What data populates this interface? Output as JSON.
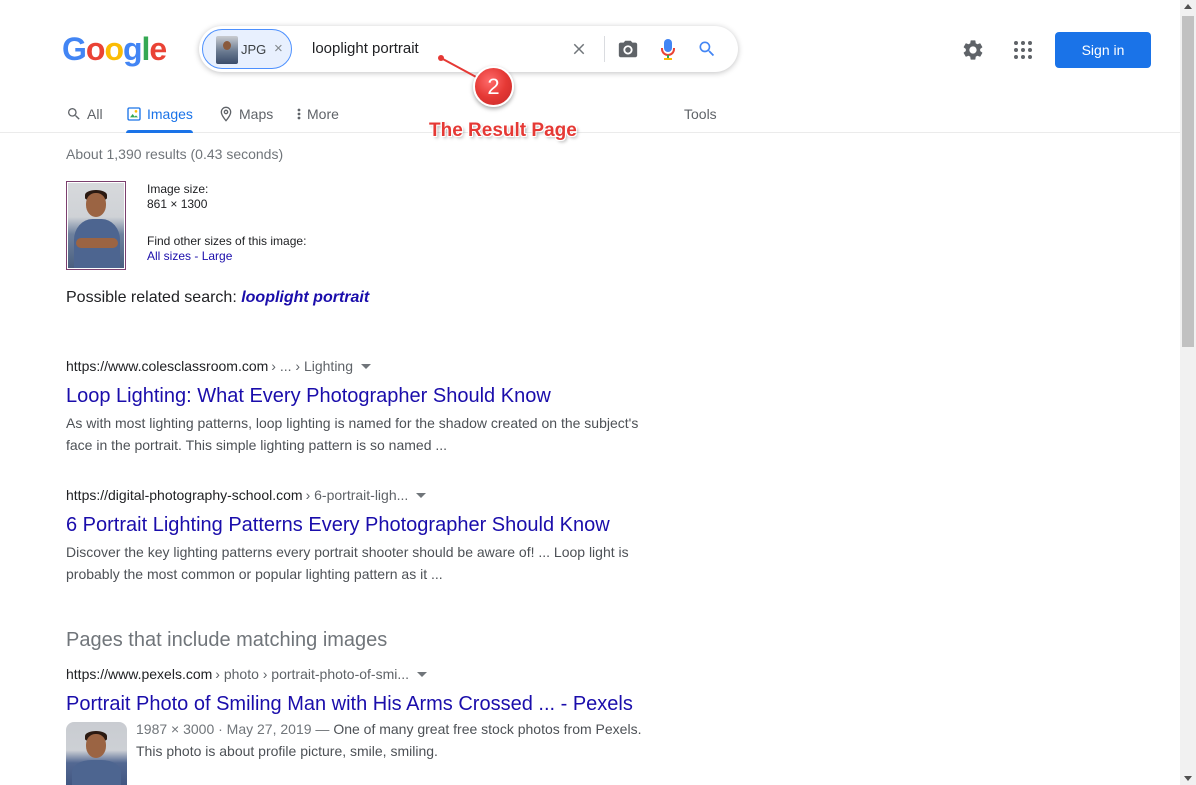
{
  "logo": {
    "letters": [
      "G",
      "o",
      "o",
      "g",
      "l",
      "e"
    ],
    "colors": [
      "#4285F4",
      "#EA4335",
      "#FBBC05",
      "#4285F4",
      "#34A853",
      "#EA4335"
    ]
  },
  "search": {
    "chip_label": "JPG",
    "chip_remove": "×",
    "query": "looplight portrait",
    "clear_icon": "close-icon",
    "camera_icon": "camera-icon",
    "mic_icon": "mic-icon",
    "search_icon": "search-icon"
  },
  "header": {
    "signin_label": "Sign in",
    "settings_icon": "gear-icon",
    "apps_icon": "apps-grid-icon",
    "accent": "#1a73e8"
  },
  "tabs": [
    {
      "label": "All",
      "icon": "search-icon",
      "active": false
    },
    {
      "label": "Images",
      "icon": "image-icon",
      "active": true
    },
    {
      "label": "Maps",
      "icon": "map-pin-icon",
      "active": false
    },
    {
      "label": "More",
      "icon": "more-vert-icon",
      "active": false
    }
  ],
  "tools_label": "Tools",
  "annotation": {
    "number": "2",
    "label": "The Result Page",
    "color": "#e53935"
  },
  "stats": "About 1,390 results (0.43 seconds)",
  "image_info": {
    "size_label": "Image size:",
    "size_value": "861 × 1300",
    "other_sizes_label": "Find other sizes of this image:",
    "all_sizes": "All sizes",
    "separator": " - ",
    "large": "Large"
  },
  "related": {
    "label": "Possible related search: ",
    "query": "looplight portrait"
  },
  "results": [
    {
      "url": "https://www.colesclassroom.com",
      "crumb": "› ... › Lighting",
      "title": "Loop Lighting: What Every Photographer Should Know",
      "snippet_line1": "As with most lighting patterns, loop lighting is named for the shadow created on the subject's",
      "snippet_line2": "face in the portrait. This simple lighting pattern is so named ..."
    },
    {
      "url": "https://digital-photography-school.com",
      "crumb": "› 6-portrait-ligh...",
      "title": "6 Portrait Lighting Patterns Every Photographer Should Know",
      "snippet_line1": "Discover the key lighting patterns every portrait shooter should be aware of! ... Loop light is",
      "snippet_line2": "probably the most common or popular lighting pattern as it ..."
    }
  ],
  "matching_section_title": "Pages that include matching images",
  "matching_result": {
    "url": "https://www.pexels.com",
    "crumb": "› photo › portrait-photo-of-smi...",
    "title": "Portrait Photo of Smiling Man with His Arms Crossed ... - Pexels",
    "meta": "1987 × 3000 · May 27, 2019 — ",
    "snippet_line1": "One of many great free stock photos from Pexels.",
    "snippet_line2": "This photo is about profile picture, smile, smiling."
  }
}
